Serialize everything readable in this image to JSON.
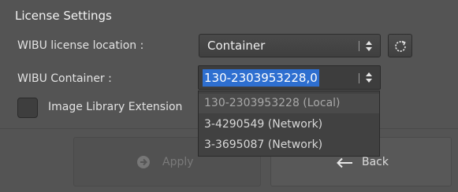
{
  "license": {
    "section_title": "License Settings",
    "location_label": "WIBU license location :",
    "location_value": "Container",
    "container_label": "WIBU Container :",
    "container_value": "130-2303953228,0",
    "image_library_label": "Image Library Extension",
    "image_library_checked": false,
    "container_options": [
      "130-2303953228 (Local)",
      "3-4290549 (Network)",
      "3-3695087 (Network)"
    ],
    "highlighted_option_index": 0
  },
  "actions": {
    "apply_label": "Apply",
    "back_label": "Back"
  },
  "icons": {
    "refresh": "refresh-icon",
    "apply": "arrow-right-circle-icon",
    "back": "arrow-left-icon"
  },
  "colors": {
    "background": "#545454",
    "selection": "#2e6fd0",
    "disabled_text": "#7a7a7a"
  }
}
